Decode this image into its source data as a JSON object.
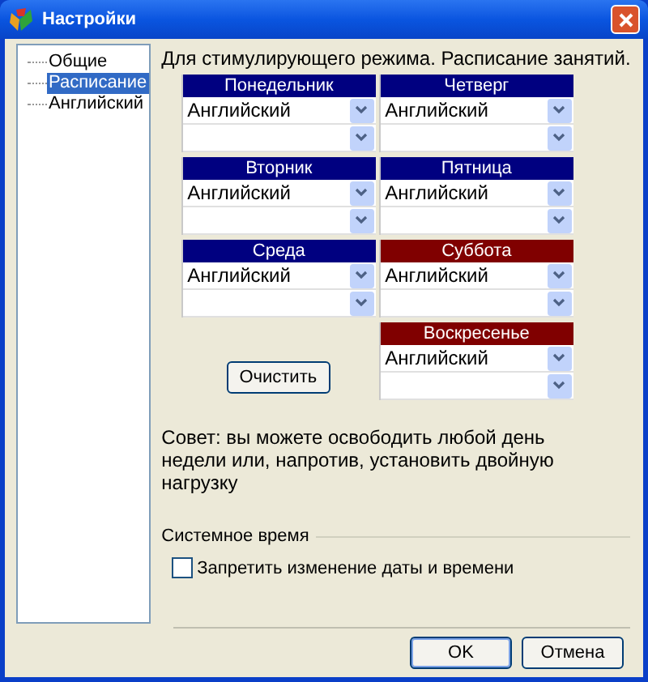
{
  "window": {
    "title": "Настройки"
  },
  "tree": {
    "items": [
      {
        "label": "Общие",
        "selected": false
      },
      {
        "label": "Расписание",
        "selected": true
      },
      {
        "label": "Английский",
        "selected": false
      }
    ]
  },
  "heading": "Для стимулирующего режима. Расписание занятий.",
  "columns": [
    {
      "days": [
        {
          "name": "Понедельник",
          "color": "#000080",
          "lesson": "Английский"
        },
        {
          "name": "Вторник",
          "color": "#000080",
          "lesson": "Английский"
        },
        {
          "name": "Среда",
          "color": "#000080",
          "lesson": "Английский"
        }
      ]
    },
    {
      "days": [
        {
          "name": "Четверг",
          "color": "#000080",
          "lesson": "Английский"
        },
        {
          "name": "Пятница",
          "color": "#000080",
          "lesson": "Английский"
        },
        {
          "name": "Суббота",
          "color": "#800000",
          "lesson": "Английский"
        },
        {
          "name": "Воскресенье",
          "color": "#800000",
          "lesson": "Английский"
        }
      ]
    }
  ],
  "clear_button": "Очистить",
  "tip": "Совет: вы можете освободить любой день недели или, напротив, установить двойную нагрузку",
  "system_time": {
    "title": "Системное время",
    "checkbox": {
      "label": "Запретить изменение даты и времени",
      "checked": false
    }
  },
  "buttons": [
    "OK",
    "Отмена"
  ]
}
